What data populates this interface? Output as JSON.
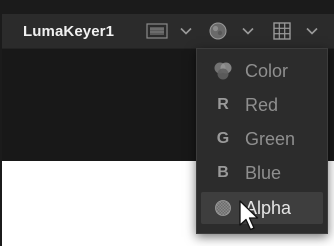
{
  "node": {
    "title": "LumaKeyer1"
  },
  "toolbar": {
    "buttons": [
      {
        "icon": "checker-swatch-icon"
      },
      {
        "icon": "channel-ball-icon"
      },
      {
        "icon": "grid-icon"
      }
    ]
  },
  "channel_menu": {
    "items": [
      {
        "label": "Color",
        "icon": "color-channels-icon",
        "letter": ""
      },
      {
        "label": "Red",
        "icon": "red-channel-icon",
        "letter": "R"
      },
      {
        "label": "Green",
        "icon": "green-channel-icon",
        "letter": "G"
      },
      {
        "label": "Blue",
        "icon": "blue-channel-icon",
        "letter": "B"
      },
      {
        "label": "Alpha",
        "icon": "alpha-channel-icon",
        "letter": "",
        "selected": true
      }
    ]
  },
  "colors": {
    "toolbar_bg": "#2b2b2b",
    "viewer_bg": "#181818",
    "menu_bg": "#2c2c2c",
    "selected_bg": "#3e3e3e",
    "label_text": "#8f8f8f",
    "selected_text": "#e4e4e4"
  }
}
